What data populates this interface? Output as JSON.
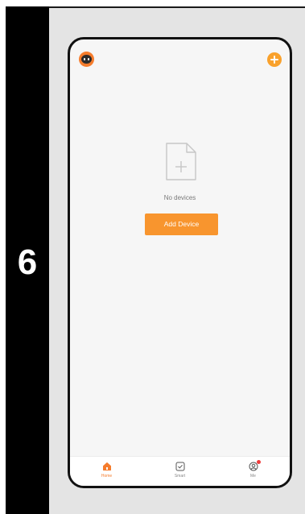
{
  "step": {
    "number": "6"
  },
  "app": {
    "header": {
      "avatar_icon": "avatar-icon",
      "add_icon": "plus-circle-icon"
    },
    "empty_state": {
      "icon": "document-plus-icon",
      "text": "No devices",
      "button_label": "Add Device"
    },
    "tabs": [
      {
        "label": "Home",
        "icon": "home-icon",
        "active": true
      },
      {
        "label": "Smart",
        "icon": "checkbox-icon",
        "active": false
      },
      {
        "label": "Me",
        "icon": "profile-icon",
        "active": false,
        "badge": true
      }
    ]
  },
  "colors": {
    "accent": "#f8952e",
    "active_tab": "#f57c2c",
    "badge": "#ef3b3b",
    "side_strip": "#000000",
    "panel_bg": "#e4e4e4",
    "screen_bg": "#f6f6f6"
  }
}
